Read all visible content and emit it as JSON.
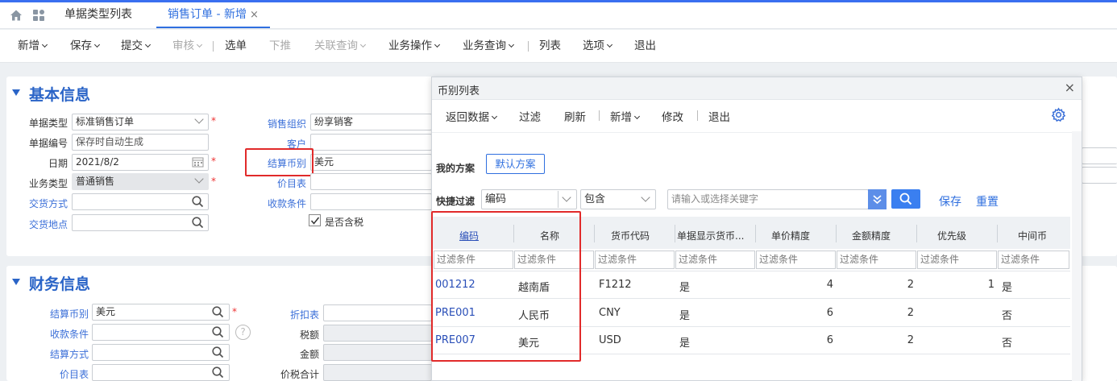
{
  "tabs": {
    "home_icon": "home-icon",
    "apps_icon": "apps-icon",
    "tab1": "单据类型列表",
    "tab2": "销售订单 - 新增",
    "close": "×"
  },
  "toolbar": {
    "new": "新增",
    "save": "保存",
    "submit": "提交",
    "audit": "审核",
    "select": "选单",
    "push": "下推",
    "related": "关联查询",
    "ops": "业务操作",
    "query": "业务查询",
    "list": "列表",
    "options": "选项",
    "exit": "退出"
  },
  "basic": {
    "title": "基本信息",
    "doc_type_label": "单据类型",
    "doc_type_value": "标准销售订单",
    "doc_no_label": "单据编号",
    "doc_no_placeholder": "保存时自动生成",
    "date_label": "日期",
    "date_value": "2021/8/2",
    "biz_type_label": "业务类型",
    "biz_type_value": "普通销售",
    "delivery_method_label": "交货方式",
    "delivery_place_label": "交货地点",
    "sales_org_label": "销售组织",
    "sales_org_value": "纷享销客",
    "customer_label": "客户",
    "currency_label": "结算币别",
    "currency_value": "美元",
    "price_list_label": "价目表",
    "payment_terms_label": "收款条件",
    "tax_included_label": "是否含税",
    "tax_included_checked": true,
    "required_mark": "*"
  },
  "finance": {
    "title": "财务信息",
    "currency_label": "结算币别",
    "currency_value": "美元",
    "payment_terms_label": "收款条件",
    "settle_method_label": "结算方式",
    "price_list_label": "价目表",
    "discount_label": "折扣表",
    "tax_label": "税额",
    "amount_label": "金额",
    "total_label": "价税合计",
    "help": "?"
  },
  "dialog": {
    "title": "币别列表",
    "close": "×",
    "buttons": {
      "return": "返回数据",
      "filter": "过滤",
      "refresh": "刷新",
      "new": "新增",
      "edit": "修改",
      "exit": "退出"
    },
    "settings_icon": "gear-icon",
    "my_scheme_label": "我的方案",
    "default_scheme": "默认方案",
    "quick_filter_label": "快捷过滤",
    "filter_field": "编码",
    "filter_op": "包含",
    "keyword_placeholder": "请输入或选择关键字",
    "save": "保存",
    "reset": "重置",
    "columns": [
      "编码",
      "名称",
      "货币代码",
      "单据显示货币...",
      "单价精度",
      "金额精度",
      "优先级",
      "中间币"
    ],
    "filter_placeholder": "过滤条件",
    "rows": [
      {
        "code": "001212",
        "name": "越南盾",
        "currency_code": "F1212",
        "show_symbol": "是",
        "price_precision": "4",
        "amount_precision": "2",
        "priority": "1",
        "intermediate": "是"
      },
      {
        "code": "PRE001",
        "name": "人民币",
        "currency_code": "CNY",
        "show_symbol": "是",
        "price_precision": "6",
        "amount_precision": "2",
        "priority": "",
        "intermediate": "否"
      },
      {
        "code": "PRE007",
        "name": "美元",
        "currency_code": "USD",
        "show_symbol": "是",
        "price_precision": "6",
        "amount_precision": "2",
        "priority": "",
        "intermediate": "否"
      }
    ]
  },
  "colors": {
    "accent": "#2f6fdf",
    "section_title": "#2a64c7",
    "highlight_box": "#e12a2a"
  }
}
